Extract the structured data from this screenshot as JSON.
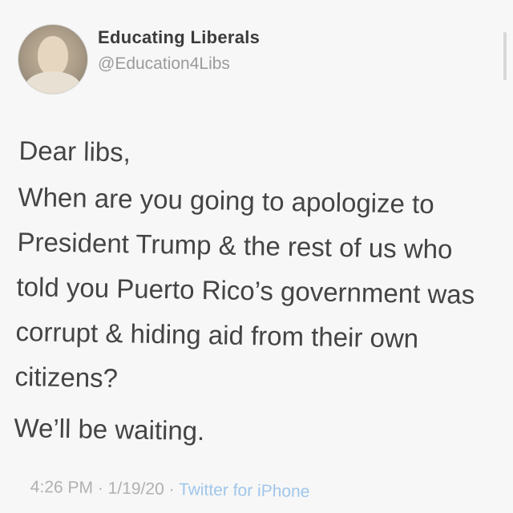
{
  "author": {
    "display_name": "Educating Liberals",
    "handle": "@Education4Libs"
  },
  "tweet": {
    "greeting": "Dear libs,",
    "question": "When are you going to apologize to President Trump & the rest of us who told you Puerto Rico’s government was corrupt & hiding aid from their own citizens?",
    "closing": "We’ll be waiting."
  },
  "meta": {
    "time": "4:26 PM",
    "separator1": " · ",
    "date": "1/19/20",
    "separator2": " · ",
    "source": "Twitter for iPhone"
  },
  "icons": {
    "avatar": "profile-photo"
  }
}
